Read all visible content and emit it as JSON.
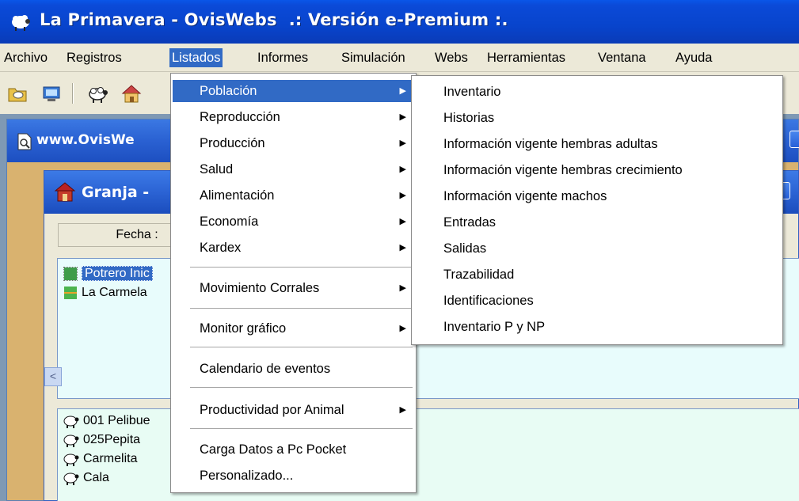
{
  "app": {
    "title": "La Primavera - OvisWebs  .: Versión e-Premium :."
  },
  "menubar": {
    "items": [
      {
        "label": "Archivo"
      },
      {
        "label": "Registros"
      },
      {
        "label": "Listados"
      },
      {
        "label": "Informes"
      },
      {
        "label": "Simulación"
      },
      {
        "label": "Webs"
      },
      {
        "label": "Herramientas"
      },
      {
        "label": "Ventana"
      },
      {
        "label": "Ayuda"
      }
    ],
    "active": "Listados"
  },
  "toolbar": {
    "icons": [
      "sheep-folder-icon",
      "network-icon",
      "sheep-icon",
      "house-icon"
    ]
  },
  "windows": {
    "outer": {
      "title": "www.OvisWe"
    },
    "granja": {
      "title": "Granja -"
    }
  },
  "granja": {
    "fecha_header": "Fecha :",
    "potreros": [
      {
        "label": "Potrero Inic",
        "selected": true
      },
      {
        "label": "La Carmela",
        "selected": false
      }
    ],
    "animals": [
      {
        "label": "001 Pelibue"
      },
      {
        "label": "025Pepita"
      },
      {
        "label": "Carmelita"
      },
      {
        "label": "Cala"
      }
    ]
  },
  "listados_menu": {
    "groups": [
      {
        "label": "Población",
        "submenu": true,
        "highlighted": true
      },
      {
        "label": "Reproducción",
        "submenu": true
      },
      {
        "label": "Producción",
        "submenu": true
      },
      {
        "label": "Salud",
        "submenu": true
      },
      {
        "label": "Alimentación",
        "submenu": true
      },
      {
        "label": "Economía",
        "submenu": true
      },
      {
        "label": "Kardex",
        "submenu": true
      },
      {
        "label": "Movimiento Corrales",
        "submenu": true
      },
      {
        "label": "Monitor gráfico",
        "submenu": true
      },
      {
        "label": "Calendario de eventos",
        "submenu": false
      },
      {
        "label": "Productividad por Animal",
        "submenu": true
      },
      {
        "label": "Carga Datos a Pc Pocket",
        "submenu": false
      },
      {
        "label": "Personalizado...",
        "submenu": false
      }
    ]
  },
  "poblacion_submenu": {
    "items": [
      {
        "label": "Inventario"
      },
      {
        "label": "Historias"
      },
      {
        "label": "Información vigente hembras adultas"
      },
      {
        "label": "Información vigente hembras crecimiento"
      },
      {
        "label": "Información vigente machos"
      },
      {
        "label": "Entradas"
      },
      {
        "label": "Salidas"
      },
      {
        "label": "Trazabilidad"
      },
      {
        "label": "Identificaciones"
      },
      {
        "label": "Inventario P y NP"
      }
    ]
  },
  "colors": {
    "titlebar": "#0b4ad8",
    "menu_highlight": "#316ac5",
    "menu_bg": "#ece9d8"
  }
}
